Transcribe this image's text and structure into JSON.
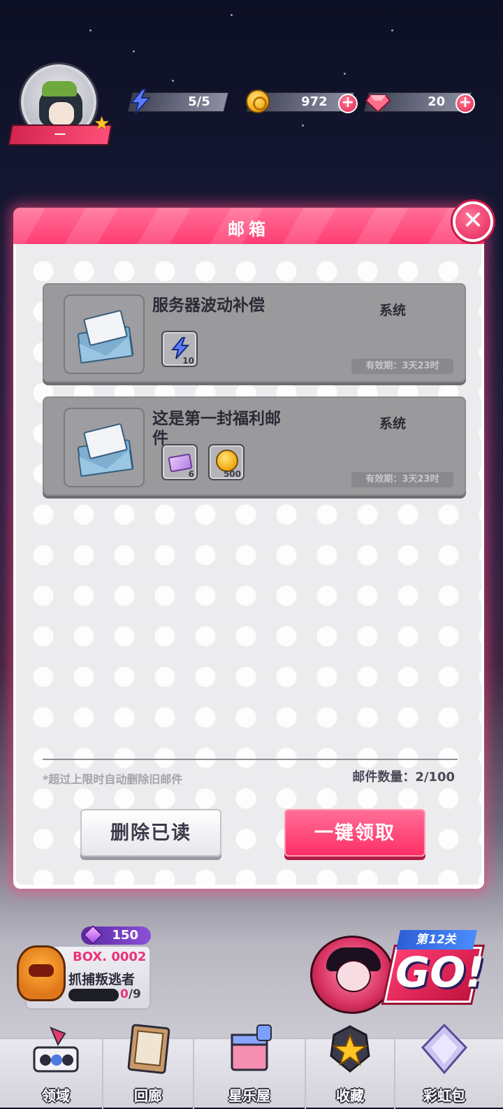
{
  "hud": {
    "level_label": "一",
    "energy": "5/5",
    "coins": "972",
    "gems": "20",
    "plus_label": "+"
  },
  "mailbox": {
    "title": "邮箱",
    "close_symbol": "✕",
    "items": [
      {
        "title": "服务器波动补偿",
        "sender": "系统",
        "expiry": "有效期：3天23时",
        "rewards": [
          {
            "icon": "energy-bolt-icon",
            "qty": "10"
          }
        ]
      },
      {
        "title": "这是第一封福利邮件",
        "sender": "系统",
        "expiry": "有效期：3天23时",
        "rewards": [
          {
            "icon": "ticket-icon",
            "qty": "6"
          },
          {
            "icon": "gold-coin-icon",
            "qty": "500"
          }
        ]
      }
    ],
    "auto_delete_note": "*超过上限时自动删除旧邮件",
    "mail_count": "邮件数量：2/100",
    "delete_read_label": "删除已读",
    "claim_all_label": "一键领取"
  },
  "box": {
    "level": "150",
    "id": "BOX. 0002",
    "task": "抓捕叛逃者",
    "progress_current": "0",
    "progress_total": "/9"
  },
  "go": {
    "stage": "第12关",
    "label": "GO!"
  },
  "nav": {
    "items": [
      {
        "label": "领域",
        "icon": "domain-icon"
      },
      {
        "label": "回廊",
        "icon": "gallery-icon"
      },
      {
        "label": "星乐屋",
        "icon": "star-house-icon"
      },
      {
        "label": "收藏",
        "icon": "collection-star-icon"
      },
      {
        "label": "彩虹包",
        "icon": "rainbow-pack-icon"
      }
    ]
  },
  "colors": {
    "accent_pink": "#ff3d73",
    "modal_bg": "#ececee",
    "mail_card": "#9a9a9c"
  }
}
